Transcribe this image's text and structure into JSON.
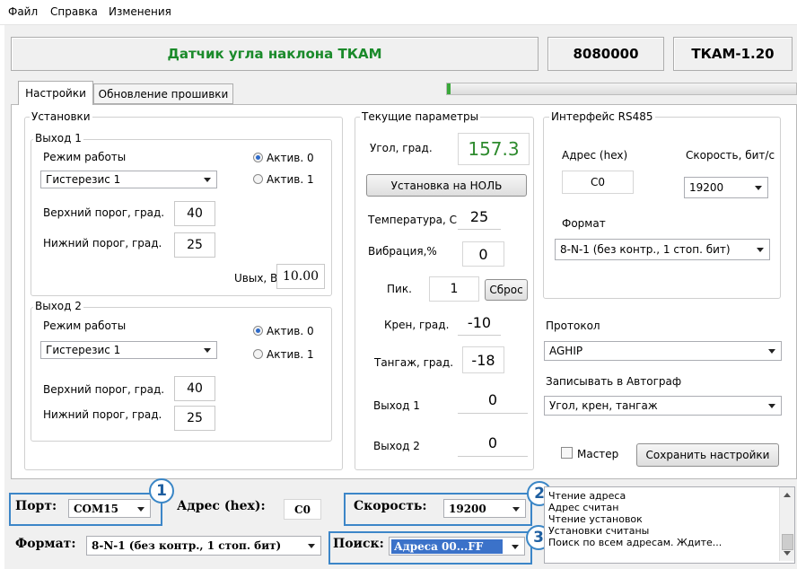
{
  "menu": {
    "file": "Файл",
    "help": "Справка",
    "changes": "Изменения"
  },
  "header": {
    "title": "Датчик угла наклона ТКАМ",
    "serial": "8080000",
    "model": "ТКАМ-1.20",
    "title_color": "#1a8a2a"
  },
  "tabs": {
    "settings": "Настройки",
    "firmware": "Обновление прошивки"
  },
  "progress": {
    "fraction": 0.01,
    "color": "#3aa83a"
  },
  "settings": {
    "title": "Установки",
    "out1": {
      "title": "Выход 1",
      "mode_label": "Режим работы",
      "mode_value": "Гистерезис 1",
      "active0": "Актив. 0",
      "active1": "Актив. 1",
      "upper_label": "Верхний порог, град.",
      "upper_value": "40",
      "lower_label": "Нижний порог, град.",
      "lower_value": "25"
    },
    "uout_label": "Uвых, В.",
    "uout_value": "10.00",
    "out2": {
      "title": "Выход 2",
      "mode_label": "Режим работы",
      "mode_value": "Гистерезис 1",
      "active0": "Актив. 0",
      "active1": "Актив. 1",
      "upper_label": "Верхний порог, град.",
      "upper_value": "40",
      "lower_label": "Нижний порог, град.",
      "lower_value": "25"
    }
  },
  "current": {
    "title": "Текущие параметры",
    "angle_label": "Угол, град.",
    "angle_value": "157.3",
    "angle_color": "#2e8b2e",
    "zero_button": "Установка на НОЛЬ",
    "temp_label": "Температура, С",
    "temp_value": "25",
    "vib_label": "Вибрация,%",
    "vib_value": "0",
    "peak_label": "Пик.",
    "peak_value": "1",
    "reset_button": "Сброс",
    "roll_label": "Крен, град.",
    "roll_value": "-10",
    "pitch_label": "Тангаж, град.",
    "pitch_value": "-18",
    "out1_label": "Выход 1",
    "out1_value": "0",
    "out2_label": "Выход 2",
    "out2_value": "0"
  },
  "rs485": {
    "title": "Интерфейс RS485",
    "addr_label": "Адрес (hex)",
    "addr_value": "C0",
    "speed_label": "Скорость, бит/с",
    "speed_value": "19200",
    "format_label": "Формат",
    "format_value": "8-N-1 (без контр., 1 стоп. бит)"
  },
  "protocol": {
    "label": "Протокол",
    "value": "AGHIP"
  },
  "autograph": {
    "label": "Записывать в Автограф",
    "value": "Угол, крен, тангаж"
  },
  "master_label": "Мастер",
  "save_button": "Сохранить настройки",
  "bottom": {
    "port_label": "Порт:",
    "port_value": "COM15",
    "addr_label": "Адрес (hex):",
    "addr_value": "C0",
    "speed_label": "Скорость:",
    "speed_value": "19200",
    "format_label": "Формат:",
    "format_value": "8-N-1 (без контр., 1 стоп. бит)",
    "search_label": "Поиск:",
    "search_value": "Адреса 00...FF"
  },
  "badges": {
    "b1": "1",
    "b2": "2",
    "b3": "3"
  },
  "log": [
    "Чтение адреса",
    "Адрес считан",
    "Чтение установок",
    "Установки считаны",
    "Поиск по всем адресам. Ждите..."
  ]
}
